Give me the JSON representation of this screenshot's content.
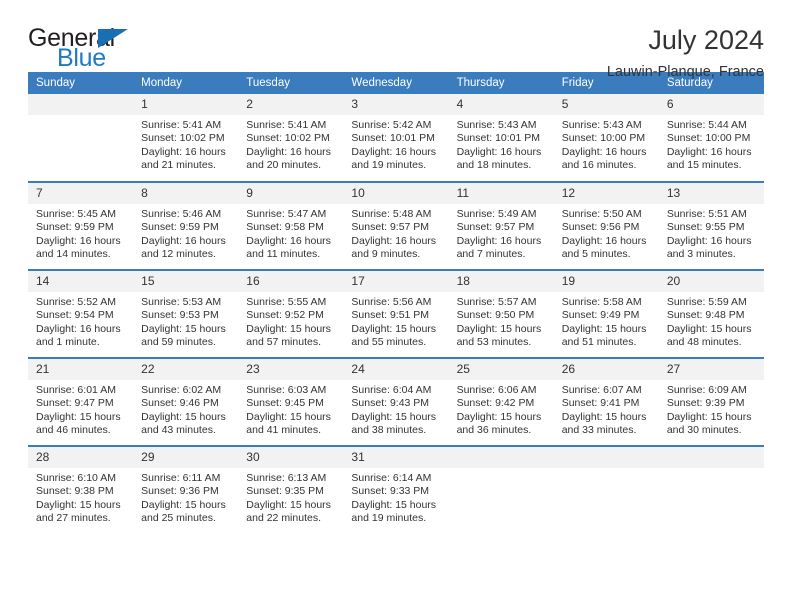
{
  "logo": {
    "word1": "General",
    "word2": "Blue",
    "triangle_color": "#1a6fb4",
    "word2_color": "#1f7ac4"
  },
  "header": {
    "title": "July 2024",
    "subtitle": "Lauwin-Planque, France"
  },
  "theme": {
    "header_bg": "#3a7cbe",
    "daynum_bg": "#f2f2f2",
    "text": "#333333"
  },
  "calendar": {
    "weekday_headers": [
      "Sunday",
      "Monday",
      "Tuesday",
      "Wednesday",
      "Thursday",
      "Friday",
      "Saturday"
    ],
    "weeks": [
      [
        {
          "day": "",
          "lines": []
        },
        {
          "day": "1",
          "lines": [
            "Sunrise: 5:41 AM",
            "Sunset: 10:02 PM",
            "Daylight: 16 hours",
            "and 21 minutes."
          ]
        },
        {
          "day": "2",
          "lines": [
            "Sunrise: 5:41 AM",
            "Sunset: 10:02 PM",
            "Daylight: 16 hours",
            "and 20 minutes."
          ]
        },
        {
          "day": "3",
          "lines": [
            "Sunrise: 5:42 AM",
            "Sunset: 10:01 PM",
            "Daylight: 16 hours",
            "and 19 minutes."
          ]
        },
        {
          "day": "4",
          "lines": [
            "Sunrise: 5:43 AM",
            "Sunset: 10:01 PM",
            "Daylight: 16 hours",
            "and 18 minutes."
          ]
        },
        {
          "day": "5",
          "lines": [
            "Sunrise: 5:43 AM",
            "Sunset: 10:00 PM",
            "Daylight: 16 hours",
            "and 16 minutes."
          ]
        },
        {
          "day": "6",
          "lines": [
            "Sunrise: 5:44 AM",
            "Sunset: 10:00 PM",
            "Daylight: 16 hours",
            "and 15 minutes."
          ]
        }
      ],
      [
        {
          "day": "7",
          "lines": [
            "Sunrise: 5:45 AM",
            "Sunset: 9:59 PM",
            "Daylight: 16 hours",
            "and 14 minutes."
          ]
        },
        {
          "day": "8",
          "lines": [
            "Sunrise: 5:46 AM",
            "Sunset: 9:59 PM",
            "Daylight: 16 hours",
            "and 12 minutes."
          ]
        },
        {
          "day": "9",
          "lines": [
            "Sunrise: 5:47 AM",
            "Sunset: 9:58 PM",
            "Daylight: 16 hours",
            "and 11 minutes."
          ]
        },
        {
          "day": "10",
          "lines": [
            "Sunrise: 5:48 AM",
            "Sunset: 9:57 PM",
            "Daylight: 16 hours",
            "and 9 minutes."
          ]
        },
        {
          "day": "11",
          "lines": [
            "Sunrise: 5:49 AM",
            "Sunset: 9:57 PM",
            "Daylight: 16 hours",
            "and 7 minutes."
          ]
        },
        {
          "day": "12",
          "lines": [
            "Sunrise: 5:50 AM",
            "Sunset: 9:56 PM",
            "Daylight: 16 hours",
            "and 5 minutes."
          ]
        },
        {
          "day": "13",
          "lines": [
            "Sunrise: 5:51 AM",
            "Sunset: 9:55 PM",
            "Daylight: 16 hours",
            "and 3 minutes."
          ]
        }
      ],
      [
        {
          "day": "14",
          "lines": [
            "Sunrise: 5:52 AM",
            "Sunset: 9:54 PM",
            "Daylight: 16 hours",
            "and 1 minute."
          ]
        },
        {
          "day": "15",
          "lines": [
            "Sunrise: 5:53 AM",
            "Sunset: 9:53 PM",
            "Daylight: 15 hours",
            "and 59 minutes."
          ]
        },
        {
          "day": "16",
          "lines": [
            "Sunrise: 5:55 AM",
            "Sunset: 9:52 PM",
            "Daylight: 15 hours",
            "and 57 minutes."
          ]
        },
        {
          "day": "17",
          "lines": [
            "Sunrise: 5:56 AM",
            "Sunset: 9:51 PM",
            "Daylight: 15 hours",
            "and 55 minutes."
          ]
        },
        {
          "day": "18",
          "lines": [
            "Sunrise: 5:57 AM",
            "Sunset: 9:50 PM",
            "Daylight: 15 hours",
            "and 53 minutes."
          ]
        },
        {
          "day": "19",
          "lines": [
            "Sunrise: 5:58 AM",
            "Sunset: 9:49 PM",
            "Daylight: 15 hours",
            "and 51 minutes."
          ]
        },
        {
          "day": "20",
          "lines": [
            "Sunrise: 5:59 AM",
            "Sunset: 9:48 PM",
            "Daylight: 15 hours",
            "and 48 minutes."
          ]
        }
      ],
      [
        {
          "day": "21",
          "lines": [
            "Sunrise: 6:01 AM",
            "Sunset: 9:47 PM",
            "Daylight: 15 hours",
            "and 46 minutes."
          ]
        },
        {
          "day": "22",
          "lines": [
            "Sunrise: 6:02 AM",
            "Sunset: 9:46 PM",
            "Daylight: 15 hours",
            "and 43 minutes."
          ]
        },
        {
          "day": "23",
          "lines": [
            "Sunrise: 6:03 AM",
            "Sunset: 9:45 PM",
            "Daylight: 15 hours",
            "and 41 minutes."
          ]
        },
        {
          "day": "24",
          "lines": [
            "Sunrise: 6:04 AM",
            "Sunset: 9:43 PM",
            "Daylight: 15 hours",
            "and 38 minutes."
          ]
        },
        {
          "day": "25",
          "lines": [
            "Sunrise: 6:06 AM",
            "Sunset: 9:42 PM",
            "Daylight: 15 hours",
            "and 36 minutes."
          ]
        },
        {
          "day": "26",
          "lines": [
            "Sunrise: 6:07 AM",
            "Sunset: 9:41 PM",
            "Daylight: 15 hours",
            "and 33 minutes."
          ]
        },
        {
          "day": "27",
          "lines": [
            "Sunrise: 6:09 AM",
            "Sunset: 9:39 PM",
            "Daylight: 15 hours",
            "and 30 minutes."
          ]
        }
      ],
      [
        {
          "day": "28",
          "lines": [
            "Sunrise: 6:10 AM",
            "Sunset: 9:38 PM",
            "Daylight: 15 hours",
            "and 27 minutes."
          ]
        },
        {
          "day": "29",
          "lines": [
            "Sunrise: 6:11 AM",
            "Sunset: 9:36 PM",
            "Daylight: 15 hours",
            "and 25 minutes."
          ]
        },
        {
          "day": "30",
          "lines": [
            "Sunrise: 6:13 AM",
            "Sunset: 9:35 PM",
            "Daylight: 15 hours",
            "and 22 minutes."
          ]
        },
        {
          "day": "31",
          "lines": [
            "Sunrise: 6:14 AM",
            "Sunset: 9:33 PM",
            "Daylight: 15 hours",
            "and 19 minutes."
          ]
        },
        {
          "day": "",
          "lines": []
        },
        {
          "day": "",
          "lines": []
        },
        {
          "day": "",
          "lines": []
        }
      ]
    ]
  }
}
